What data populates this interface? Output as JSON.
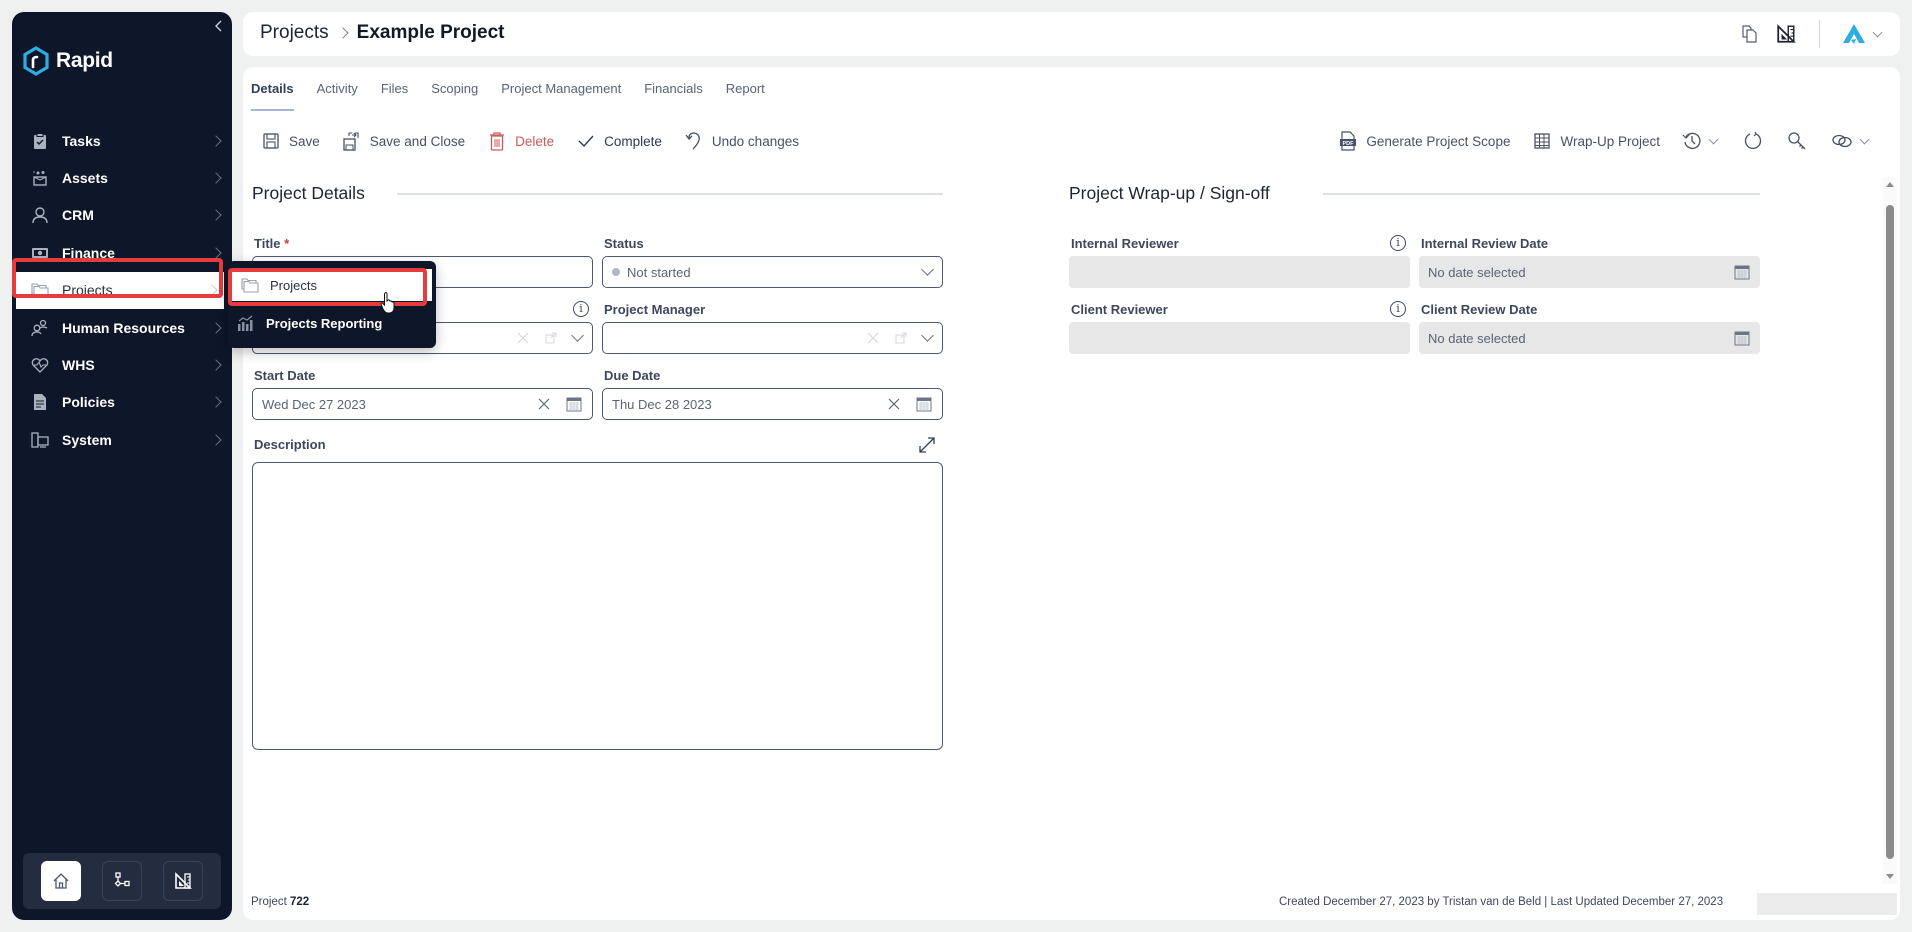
{
  "sidebar": {
    "brand": "Rapid",
    "collapse_icon": "chevron-left-icon",
    "items": [
      {
        "label": "Tasks",
        "icon": "clipboard-check-icon"
      },
      {
        "label": "Assets",
        "icon": "assets-box-icon"
      },
      {
        "label": "CRM",
        "icon": "person-icon"
      },
      {
        "label": "Finance",
        "icon": "banknote-icon"
      },
      {
        "label": "Projects",
        "icon": "folders-icon",
        "active": true
      },
      {
        "label": "Human Resources",
        "icon": "people-icon"
      },
      {
        "label": "WHS",
        "icon": "heart-pulse-icon"
      },
      {
        "label": "Policies",
        "icon": "document-icon"
      },
      {
        "label": "System",
        "icon": "system-icon"
      }
    ],
    "dock": [
      {
        "name": "home",
        "icon": "home-icon",
        "active": true
      },
      {
        "name": "workflow",
        "icon": "workflow-icon"
      },
      {
        "name": "ruler",
        "icon": "set-square-icon"
      }
    ]
  },
  "submenu": {
    "items": [
      {
        "label": "Projects",
        "icon": "folders-icon",
        "hover": true
      },
      {
        "label": "Projects Reporting",
        "icon": "bar-chart-icon"
      }
    ]
  },
  "header": {
    "breadcrumb_root": "Projects",
    "breadcrumb_current": "Example Project",
    "icons": [
      "copy-icon",
      "set-square-icon",
      "user-logo-icon"
    ]
  },
  "tabs": [
    "Details",
    "Activity",
    "Files",
    "Scoping",
    "Project Management",
    "Financials",
    "Report"
  ],
  "active_tab": "Details",
  "toolbar": {
    "save": "Save",
    "save_close": "Save and Close",
    "delete": "Delete",
    "complete": "Complete",
    "undo": "Undo changes",
    "generate_scope": "Generate Project Scope",
    "wrap_up": "Wrap-Up Project"
  },
  "details": {
    "section_title": "Project Details",
    "title_label": "Title",
    "title_required": "*",
    "title_value": "",
    "status_label": "Status",
    "status_value": "Not started",
    "client_label": "",
    "client_value": "",
    "pm_label": "Project Manager",
    "pm_value": "",
    "start_label": "Start Date",
    "start_value": "Wed Dec 27 2023",
    "due_label": "Due Date",
    "due_value": "Thu Dec 28 2023",
    "description_label": "Description",
    "description_value": ""
  },
  "wrapup": {
    "section_title": "Project Wrap-up / Sign-off",
    "internal_reviewer_label": "Internal Reviewer",
    "internal_review_date_label": "Internal Review Date",
    "internal_review_date_value": "No date selected",
    "client_reviewer_label": "Client Reviewer",
    "client_review_date_label": "Client Review Date",
    "client_review_date_value": "No date selected"
  },
  "footer": {
    "project_prefix": "Project",
    "project_number": "722",
    "meta": "Created December 27, 2023 by Tristan van de Beld | Last Updated December 27, 2023"
  },
  "colors": {
    "sidebar_bg": "#0e1629",
    "highlight": "#e63c3c",
    "accent": "#2eaee0",
    "danger": "#cc5a5a"
  }
}
